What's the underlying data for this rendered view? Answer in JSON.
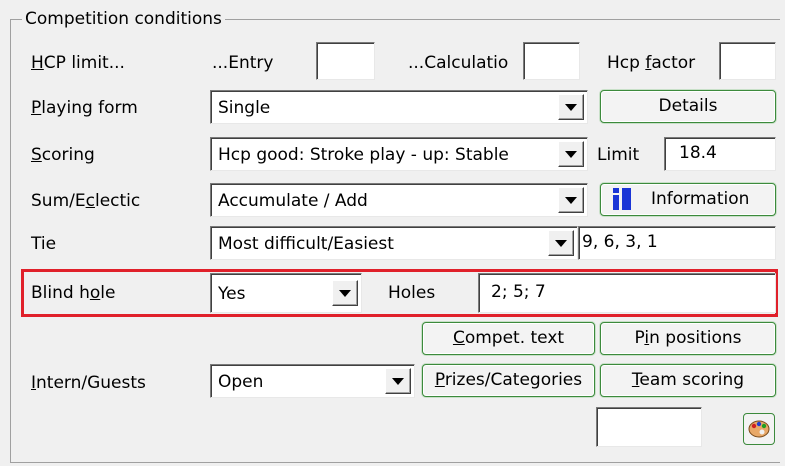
{
  "group_title": "Competition conditions",
  "hcp_limit": {
    "label_u": "H",
    "label_rest": "CP limit...",
    "entry_label": "...Entry",
    "entry_value": "",
    "calc_label": "...Calculatio",
    "calc_value": "",
    "factor_label_a": "Hcp ",
    "factor_label_u": "f",
    "factor_label_b": "actor",
    "factor_value": ""
  },
  "playing_form": {
    "label_u": "P",
    "label_rest": "laying form",
    "value": "Single",
    "details_button": "Details"
  },
  "scoring": {
    "label_u": "S",
    "label_rest": "coring",
    "value": "Hcp good: Stroke play - up: Stable",
    "limit_label": "Limit",
    "limit_value": "18.4"
  },
  "sum_eclectic": {
    "label_a": "Sum/E",
    "label_u": "c",
    "label_b": "lectic",
    "value": "Accumulate / Add",
    "information_button": "Information",
    "information_icon": "info-icon"
  },
  "tie": {
    "label": "Tie",
    "value": "Most difficult/Easiest",
    "holes_value": "9, 6, 3, 1"
  },
  "blind_hole": {
    "label_a": "Blind h",
    "label_u": "o",
    "label_b": "le",
    "value": "Yes",
    "holes_label": "Holes",
    "holes_value": "2; 5; 7"
  },
  "buttons": {
    "compet_text_u": "C",
    "compet_text_rest": "ompet. text",
    "pin_positions_a": "P",
    "pin_positions_u": "i",
    "pin_positions_b": "n positions",
    "prizes_u": "P",
    "prizes_rest": "rizes/Categories",
    "team_scoring_u": "T",
    "team_scoring_rest": "eam scoring"
  },
  "intern_guests": {
    "label_u": "I",
    "label_rest": "ntern/Guests",
    "value": "Open"
  },
  "bottom_field_value": "",
  "palette_icon": "palette-icon",
  "colors": {
    "highlight": "#e0202a",
    "button_border": "#3c8a3c",
    "info_blue": "#1a35d6"
  }
}
